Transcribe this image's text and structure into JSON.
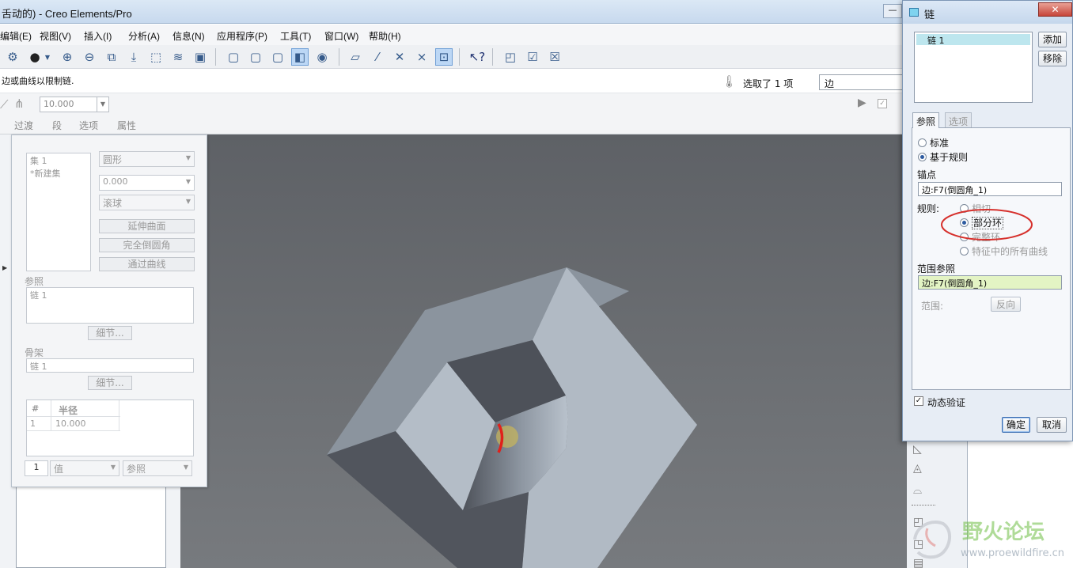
{
  "window": {
    "title": "舌动的) - Creo Elements/Pro",
    "minimize_label": "—"
  },
  "menu": {
    "items": [
      "编辑(E)",
      "视图(V)",
      "插入(I)",
      "分析(A)",
      "信息(N)",
      "应用程序(P)",
      "工具(T)",
      "窗口(W)",
      "帮助(H)"
    ]
  },
  "message": {
    "text": "边或曲线以限制链.",
    "selection_count": "选取了 1 项",
    "filter_value": "边"
  },
  "dashboard": {
    "radius_value": "10.000",
    "tabs": [
      "过渡",
      "段",
      "选项",
      "属性"
    ]
  },
  "round_panel": {
    "sets": [
      "集 1",
      "*新建集"
    ],
    "shape": "圆形",
    "value": "0.000",
    "method": "滚球",
    "extend_button": "延伸曲面",
    "full_round_button": "完全倒圆角",
    "through_curve_button": "通过曲线",
    "references_label": "参照",
    "references_value": "链 1",
    "details_button": "细节...",
    "spine_label": "骨架",
    "spine_value": "链 1",
    "details_button2": "细节...",
    "table": {
      "headers": [
        "#",
        "半径"
      ],
      "rows": [
        [
          "1",
          "10.000"
        ]
      ]
    },
    "bottom_index": "1",
    "bottom_value": "值",
    "bottom_reference": "参照"
  },
  "chain_dialog": {
    "title": "链",
    "close_label": "✕",
    "chains": [
      "链 1"
    ],
    "add_button": "添加",
    "remove_button": "移除",
    "tabs": [
      "参照",
      "选项"
    ],
    "type_options": [
      "标准",
      "基于规则"
    ],
    "type_selected": "基于规则",
    "anchor_label": "锚点",
    "anchor_value": "边:F7(倒圆角_1)",
    "rule_label": "规则:",
    "rule_options": [
      "相切",
      "部分环",
      "完整环",
      "特征中的所有曲线"
    ],
    "rule_selected": "部分环",
    "range_ref_label": "范围参照",
    "range_ref_value": "边:F7(倒圆角_1)",
    "range_label": "范围:",
    "reverse_button": "反向",
    "dynamic_validate_label": "动态验证",
    "dynamic_validate_checked": true,
    "ok_button": "确定",
    "cancel_button": "取消"
  },
  "watermark": {
    "name": "野火论坛",
    "url": "www.proewildfire.cn"
  },
  "colors": {
    "viewport_bg": "#65686c",
    "part_light": "#b3bcc6",
    "part_dark": "#4b4f57",
    "selection_highlight": "#e0211b",
    "annotation_circle": "#d6302c"
  }
}
